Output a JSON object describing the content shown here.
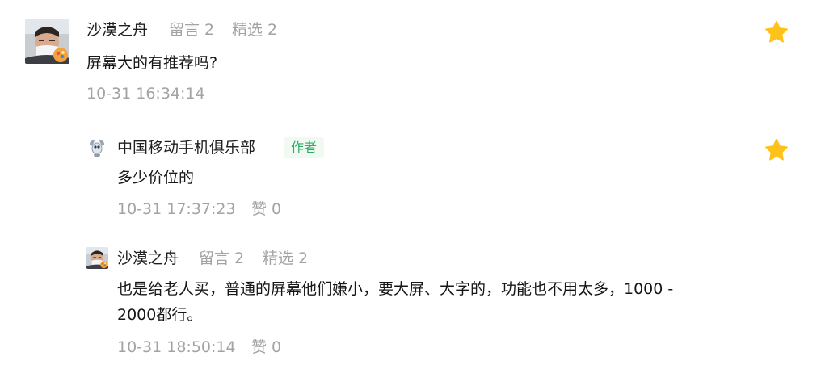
{
  "colors": {
    "star": "#FFC21A",
    "author_tag_text": "#2BAB63",
    "author_tag_bg": "#F1F9F3",
    "meta_gray": "#A3A3A3"
  },
  "comments": [
    {
      "user": "沙漠之舟",
      "meta_messages": "留言 2",
      "meta_featured": "精选 2",
      "text": "屏幕大的有推荐吗?",
      "time": "10-31 16:34:14",
      "avatar_icon": "user-photo-avatar",
      "star_icon": "star-icon"
    }
  ],
  "replies": [
    {
      "user": "中国移动手机俱乐部",
      "tag": "作者",
      "text": "多少价位的",
      "time": "10-31 17:37:23",
      "like": "赞 0",
      "avatar_icon": "robot-logo-avatar",
      "star_icon": "star-icon"
    },
    {
      "user": "沙漠之舟",
      "meta_messages": "留言 2",
      "meta_featured": "精选 2",
      "text": "也是给老人买，普通的屏幕他们嫌小，要大屏、大字的，功能也不用太多，1000 - 2000都行。",
      "time": "10-31 18:50:14",
      "like": "赞 0",
      "avatar_icon": "user-photo-avatar"
    }
  ]
}
